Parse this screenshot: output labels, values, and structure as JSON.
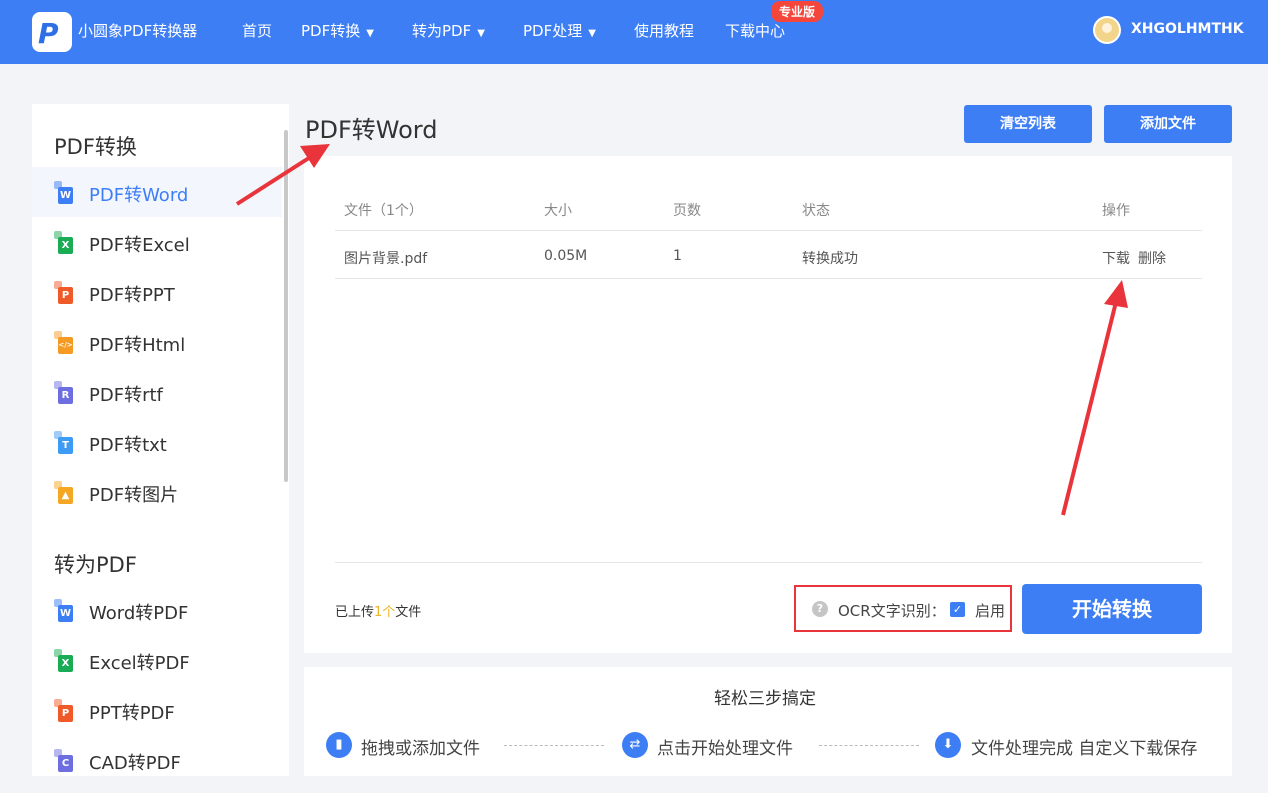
{
  "app": {
    "brand": "小圆象PDF转换器",
    "nav": [
      {
        "label": "首页",
        "caret": false
      },
      {
        "label": "PDF转换",
        "caret": true
      },
      {
        "label": "转为PDF",
        "caret": true
      },
      {
        "label": "PDF处理",
        "caret": true
      },
      {
        "label": "使用教程",
        "caret": false
      },
      {
        "label": "下载中心",
        "caret": false
      }
    ],
    "pro_badge": "专业版",
    "username": "XHGOLHMTHK"
  },
  "sidebar": {
    "group1_title": "PDF转换",
    "group1_items": [
      {
        "label": "PDF转Word",
        "icon": "word-doc-icon",
        "glyph": "W",
        "color": "#3d7ef5",
        "active": true
      },
      {
        "label": "PDF转Excel",
        "icon": "excel-doc-icon",
        "glyph": "X",
        "color": "#1aab55",
        "active": false
      },
      {
        "label": "PDF转PPT",
        "icon": "ppt-doc-icon",
        "glyph": "P",
        "color": "#f05a28",
        "active": false
      },
      {
        "label": "PDF转Html",
        "icon": "html-doc-icon",
        "glyph": "</>",
        "color": "#f59a23",
        "active": false
      },
      {
        "label": "PDF转rtf",
        "icon": "rtf-doc-icon",
        "glyph": "R",
        "color": "#6d6fe0",
        "active": false
      },
      {
        "label": "PDF转txt",
        "icon": "txt-doc-icon",
        "glyph": "T",
        "color": "#3d9af5",
        "active": false
      },
      {
        "label": "PDF转图片",
        "icon": "image-doc-icon",
        "glyph": "▲",
        "color": "#f5a623",
        "active": false
      }
    ],
    "group2_title": "转为PDF",
    "group2_items": [
      {
        "label": "Word转PDF",
        "icon": "word-to-pdf-icon",
        "glyph": "W",
        "color": "#3d7ef5"
      },
      {
        "label": "Excel转PDF",
        "icon": "excel-to-pdf-icon",
        "glyph": "X",
        "color": "#1aab55"
      },
      {
        "label": "PPT转PDF",
        "icon": "ppt-to-pdf-icon",
        "glyph": "P",
        "color": "#f05a28"
      },
      {
        "label": "CAD转PDF",
        "icon": "cad-to-pdf-icon",
        "glyph": "C",
        "color": "#6d6fe0"
      }
    ]
  },
  "main": {
    "title": "PDF转Word",
    "clear_btn": "清空列表",
    "add_btn": "添加文件",
    "table": {
      "headers": [
        "文件（1个）",
        "大小",
        "页数",
        "状态",
        "操作"
      ],
      "rows": [
        {
          "name": "图片背景.pdf",
          "size": "0.05M",
          "pages": "1",
          "status": "转换成功",
          "download": "下载",
          "delete": "删除"
        }
      ]
    },
    "upload_prefix": "已上传",
    "upload_count": "1个",
    "upload_suffix": "文件",
    "ocr_help": "?",
    "ocr_label": "OCR文字识别：",
    "ocr_enabled": true,
    "ocr_enable_label": "启用",
    "start_btn": "开始转换"
  },
  "steps": {
    "title": "轻松三步搞定",
    "items": [
      {
        "label": "拖拽或添加文件",
        "icon": "file-icon"
      },
      {
        "label": "点击开始处理文件",
        "icon": "convert-icon"
      },
      {
        "label": "文件处理完成 自定义下载保存",
        "icon": "download-icon"
      }
    ]
  },
  "colors": {
    "accent": "#3d7ef5",
    "badge": "#f5463c",
    "annotation": "#e8343a",
    "highlight": "#f0b428"
  }
}
